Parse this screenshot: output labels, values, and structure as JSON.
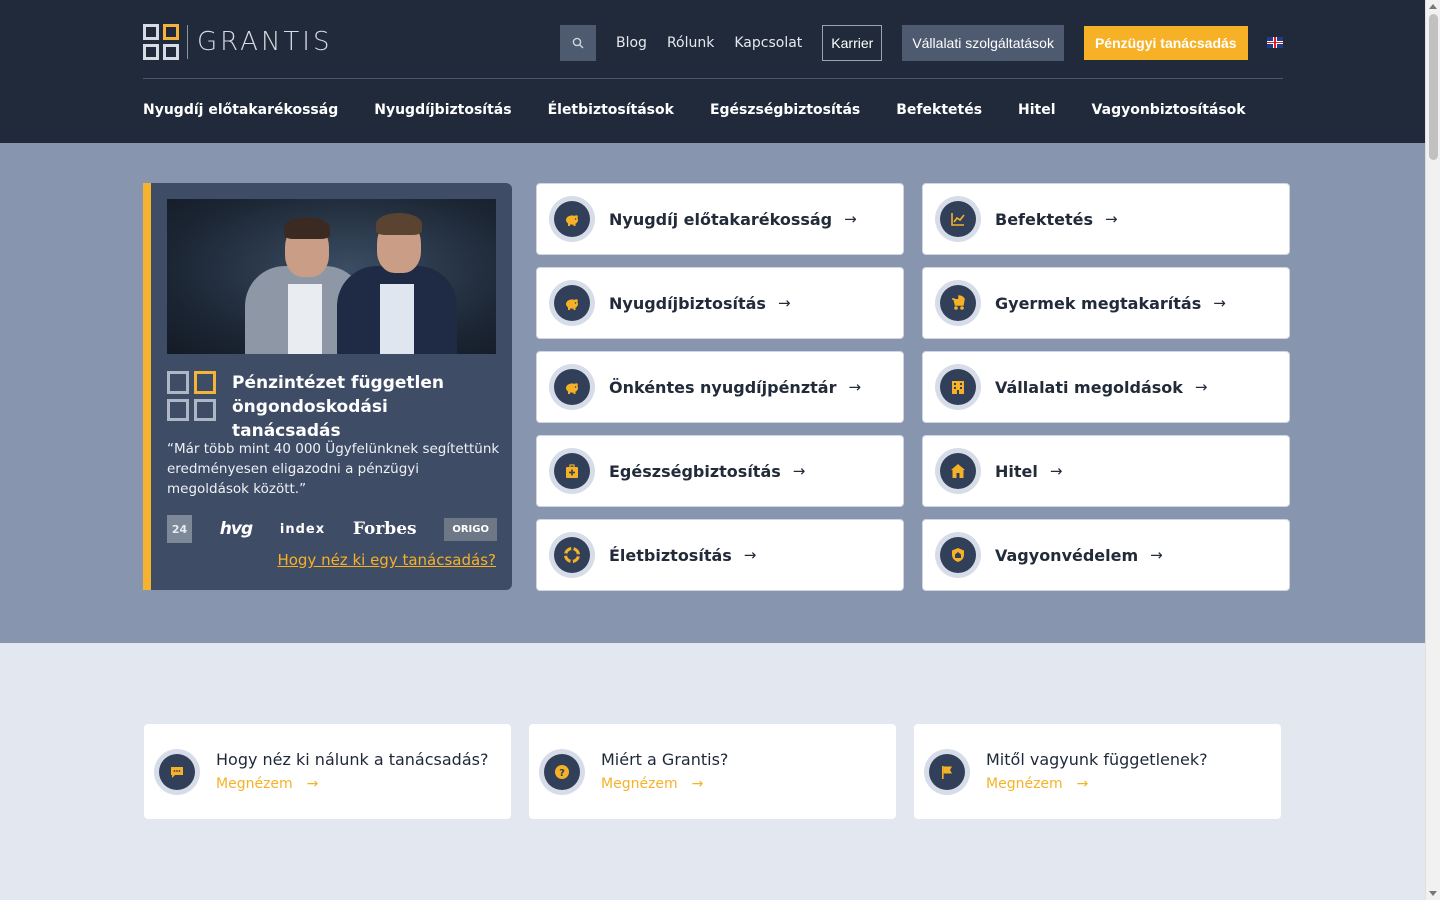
{
  "brand": {
    "name": "GRANTIS"
  },
  "topnav": {
    "links": [
      "Blog",
      "Rólunk",
      "Kapcsolat"
    ],
    "karrier": "Karrier",
    "vallalati": "Vállalati szolgáltatások",
    "penzugyi": "Pénzügyi tanácsadás",
    "language_flag": "uk-flag-icon"
  },
  "mainnav": [
    "Nyugdíj előtakarékosság",
    "Nyugdíjbiztosítás",
    "Életbiztosítások",
    "Egészségbiztosítás",
    "Befektetés",
    "Hitel",
    "Vagyonbiztosítások"
  ],
  "promo": {
    "title": "Pénzintézet független öngondoskodási tanácsadás",
    "quote": "“Már több mint 40 000 Ügyfelünknek segítettünk eredményesen eligazodni a pénzügyi megoldások között.”",
    "press": [
      "24.hu",
      "hvg",
      "index",
      "Forbes",
      "ORIGO"
    ],
    "link": "Hogy néz ki egy tanácsadás?"
  },
  "cards": [
    {
      "label": "Nyugdíj előtakarékosság",
      "icon": "piggy-bank-icon"
    },
    {
      "label": "Befektetés",
      "icon": "chart-line-icon"
    },
    {
      "label": "Nyugdíjbiztosítás",
      "icon": "piggy-bank-icon"
    },
    {
      "label": "Gyermek megtakarítás",
      "icon": "stroller-icon"
    },
    {
      "label": "Önkéntes nyugdíjpénztár",
      "icon": "piggy-bank-icon"
    },
    {
      "label": "Vállalati megoldások",
      "icon": "building-icon"
    },
    {
      "label": "Egészségbiztosítás",
      "icon": "medical-kit-icon"
    },
    {
      "label": "Hitel",
      "icon": "house-icon"
    },
    {
      "label": "Életbiztosítás",
      "icon": "lifebuoy-icon"
    },
    {
      "label": "Vagyonvédelem",
      "icon": "shield-home-icon"
    }
  ],
  "card_arrow": "→",
  "info": [
    {
      "title": "Hogy néz ki nálunk a tanácsadás?",
      "more": "Megnézem",
      "icon": "chat-icon"
    },
    {
      "title": "Miért a Grantis?",
      "more": "Megnézem",
      "icon": "question-icon"
    },
    {
      "title": "Mitől vagyunk függetlenek?",
      "more": "Megnézem",
      "icon": "flag-icon"
    }
  ],
  "colors": {
    "header": "#202a3a",
    "hero": "#8796ae",
    "accent": "#f6b127",
    "lower": "#e3e7f0"
  }
}
